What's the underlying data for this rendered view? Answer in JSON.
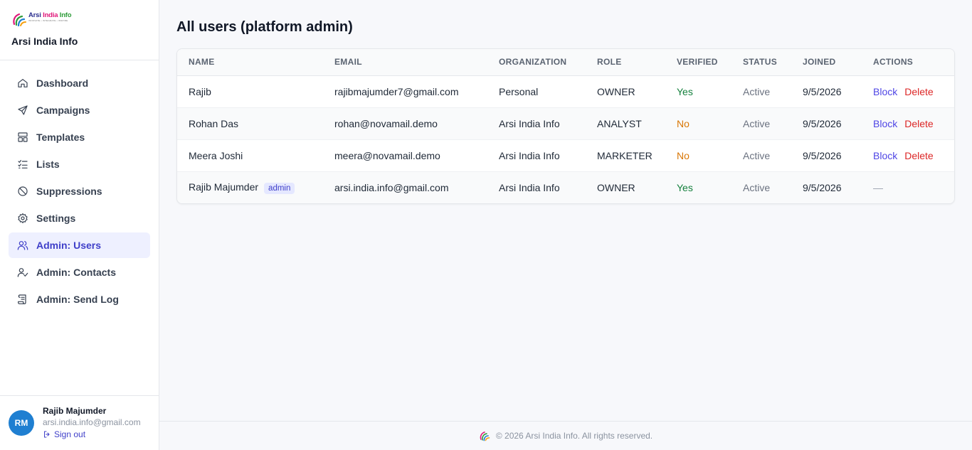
{
  "brand": {
    "logo_word1": "Arsi",
    "logo_word2": "India",
    "logo_word3": "Info",
    "logo_tagline": "INNOVATE • INTEGRATE • INSPIRE",
    "name": "Arsi India Info"
  },
  "nav": [
    {
      "label": "Dashboard",
      "icon": "home-icon"
    },
    {
      "label": "Campaigns",
      "icon": "send-icon"
    },
    {
      "label": "Templates",
      "icon": "layout-icon"
    },
    {
      "label": "Lists",
      "icon": "list-check-icon"
    },
    {
      "label": "Suppressions",
      "icon": "ban-icon"
    },
    {
      "label": "Settings",
      "icon": "gear-icon"
    },
    {
      "label": "Admin: Users",
      "icon": "users-icon",
      "active": true
    },
    {
      "label": "Admin: Contacts",
      "icon": "user-check-icon"
    },
    {
      "label": "Admin: Send Log",
      "icon": "scroll-icon"
    }
  ],
  "user": {
    "initials": "RM",
    "name": "Rajib Majumder",
    "email": "arsi.india.info@gmail.com",
    "signout_label": "Sign out"
  },
  "page": {
    "title": "All users (platform admin)"
  },
  "table": {
    "headers": [
      "NAME",
      "EMAIL",
      "ORGANIZATION",
      "ROLE",
      "VERIFIED",
      "STATUS",
      "JOINED",
      "ACTIONS"
    ],
    "rows": [
      {
        "name": "Rajib",
        "badge": "",
        "email": "rajibmajumder7@gmail.com",
        "org": "Personal",
        "role": "OWNER",
        "verified": "Yes",
        "status": "Active",
        "joined": "9/5/2026",
        "block": "Block",
        "delete": "Delete",
        "none": ""
      },
      {
        "name": "Rohan Das",
        "badge": "",
        "email": "rohan@novamail.demo",
        "org": "Arsi India Info",
        "role": "ANALYST",
        "verified": "No",
        "status": "Active",
        "joined": "9/5/2026",
        "block": "Block",
        "delete": "Delete",
        "none": ""
      },
      {
        "name": "Meera Joshi",
        "badge": "",
        "email": "meera@novamail.demo",
        "org": "Arsi India Info",
        "role": "MARKETER",
        "verified": "No",
        "status": "Active",
        "joined": "9/5/2026",
        "block": "Block",
        "delete": "Delete",
        "none": ""
      },
      {
        "name": "Rajib Majumder",
        "badge": "admin",
        "email": "arsi.india.info@gmail.com",
        "org": "Arsi India Info",
        "role": "OWNER",
        "verified": "Yes",
        "status": "Active",
        "joined": "9/5/2026",
        "block": "",
        "delete": "",
        "none": "—"
      }
    ]
  },
  "footer": {
    "text": "© 2026 Arsi India Info. All rights reserved."
  },
  "colors": {
    "accent": "#3f3fc9",
    "yes": "#15803d",
    "no": "#d97706",
    "delete": "#dc2626",
    "avatar": "#1f7fd1"
  }
}
